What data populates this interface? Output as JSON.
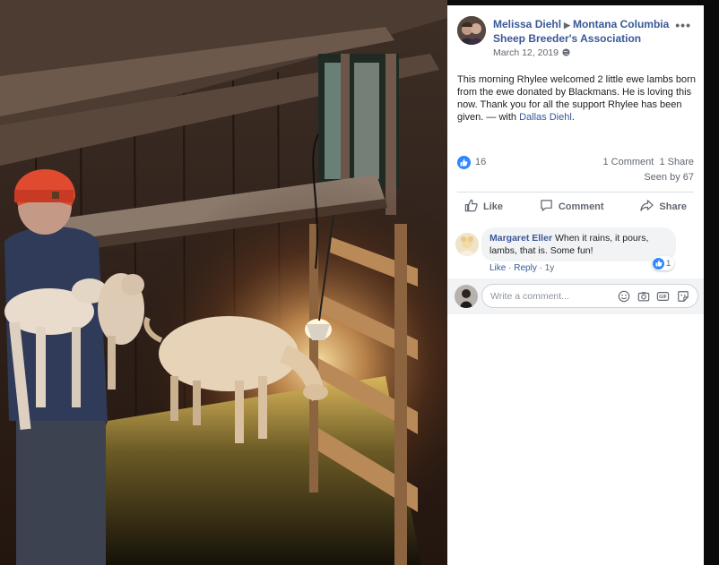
{
  "post": {
    "author": "Melissa Diehl",
    "group": "Montana Columbia Sheep Breeder's Association",
    "date": "March 12, 2019",
    "text": "This morning Rhylee welcomed 2 little ewe lambs born from the ewe donated by Blackmans. He is loving this now. Thank you for all the support Rhylee has been given.",
    "with_prefix": " — with ",
    "tagged": "Dallas Diehl",
    "tagged_suffix": "."
  },
  "stats": {
    "reaction_count": "16",
    "comments": "1 Comment",
    "shares": "1 Share",
    "seen_by": "Seen by 67"
  },
  "actions": {
    "like": "Like",
    "comment": "Comment",
    "share": "Share"
  },
  "comment": {
    "author": "Margaret Eller",
    "text": "When it rains, it pours, lambs, that is. Some fun!",
    "like": "Like",
    "separator": " · ",
    "reply": "Reply",
    "age": "1y",
    "reaction_count": "1"
  },
  "composer": {
    "placeholder": "Write a comment..."
  },
  "colors": {
    "link": "#385898",
    "like_blue": "#2d88ff",
    "meta_gray": "#606770",
    "bubble_gray": "#f2f3f5"
  },
  "icons": [
    "globe-icon",
    "more-icon",
    "like-badge-icon",
    "thumbs-up-icon",
    "comment-icon",
    "share-icon",
    "emoji-icon",
    "camera-icon",
    "gif-icon",
    "sticker-icon"
  ]
}
